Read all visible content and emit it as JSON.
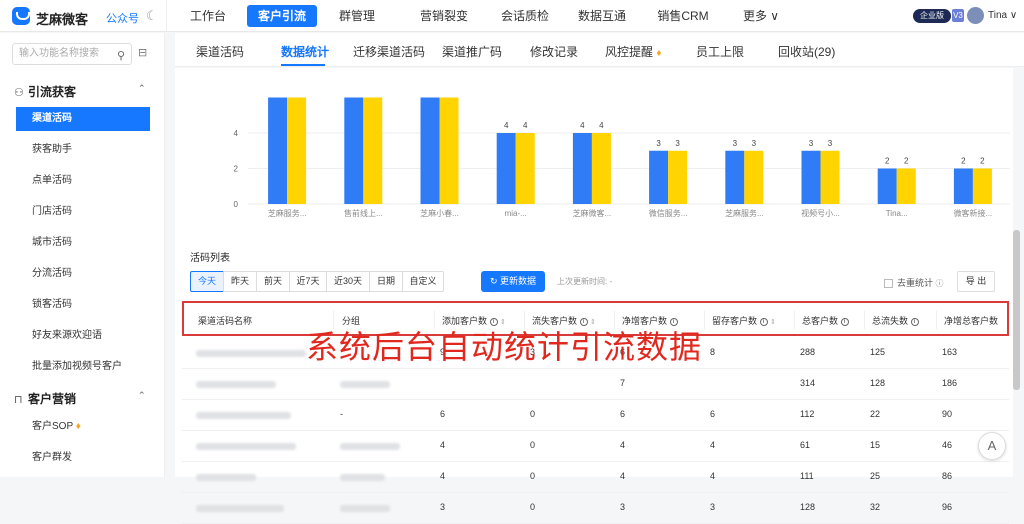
{
  "app": {
    "name": "芝麻微客",
    "gzh": "公众号",
    "user": "Tina",
    "badge_ent": "企业版",
    "badge_v": "V3"
  },
  "topnav": [
    {
      "label": "工作台"
    },
    {
      "label": "客户引流",
      "active": true
    },
    {
      "label": "群管理"
    },
    {
      "label": "营销裂变"
    },
    {
      "label": "会话质检"
    },
    {
      "label": "数据互通"
    },
    {
      "label": "销售CRM"
    },
    {
      "label": "更多 ∨"
    }
  ],
  "sidebar": {
    "search_placeholder": "输入功能名称搜索",
    "group1": "引流获客",
    "items1": [
      "渠道活码",
      "获客助手",
      "点单活码",
      "门店活码",
      "城市活码",
      "分流活码",
      "锁客活码",
      "好友来源欢迎语",
      "批量添加视频号客户"
    ],
    "group2": "客户营销",
    "items2": [
      "客户SOP",
      "客户群发"
    ]
  },
  "tabs": [
    "渠道活码",
    "数据统计",
    "迁移渠道活码",
    "渠道推广码",
    "修改记录",
    "风控提醒",
    "员工上限",
    "回收站(29)"
  ],
  "chart_data": {
    "type": "bar",
    "categories": [
      "芝麻服务...",
      "售前线上...",
      "芝麻小春...",
      "mia-...",
      "芝麻微客...",
      "微信服务...",
      "芝麻服务...",
      "视频号小...",
      "Tina...",
      "微客新接..."
    ],
    "series": [
      {
        "color": "#2f7cf6",
        "values": [
          6,
          6,
          6,
          4,
          4,
          3,
          3,
          3,
          2,
          2
        ]
      },
      {
        "color": "#ffd400",
        "values": [
          6,
          6,
          6,
          4,
          4,
          3,
          3,
          3,
          2,
          2
        ]
      }
    ],
    "value_labels_shown_from_index": 3,
    "yticks": [
      0,
      2,
      4
    ],
    "ylim": [
      0,
      6
    ]
  },
  "table": {
    "title": "活码列表",
    "filters": [
      "今天",
      "昨天",
      "前天",
      "近7天",
      "近30天",
      "日期",
      "自定义"
    ],
    "refresh": "更新数据",
    "last_update": "上次更新时间: -",
    "dedup": "去重统计",
    "export": "导 出",
    "headers": [
      "渠道活码名称",
      "分组",
      "添加客户数",
      "流失客户数",
      "净增客户数",
      "留存客户数",
      "总客户数",
      "总流失数",
      "净增总客户数"
    ],
    "rows": [
      [
        "",
        "",
        "9",
        "3",
        "6",
        "8",
        "288",
        "125",
        "163"
      ],
      [
        "",
        "",
        "",
        "",
        "7",
        "",
        "314",
        "128",
        "186"
      ],
      [
        "",
        "-",
        "6",
        "0",
        "6",
        "6",
        "112",
        "22",
        "90"
      ],
      [
        "",
        "",
        "4",
        "0",
        "4",
        "4",
        "61",
        "15",
        "46"
      ],
      [
        "",
        "",
        "4",
        "0",
        "4",
        "4",
        "111",
        "25",
        "86"
      ],
      [
        "",
        "",
        "3",
        "0",
        "3",
        "3",
        "128",
        "32",
        "96"
      ]
    ]
  },
  "overlay_text": "系统后台自动统计引流数据",
  "fab": "A"
}
